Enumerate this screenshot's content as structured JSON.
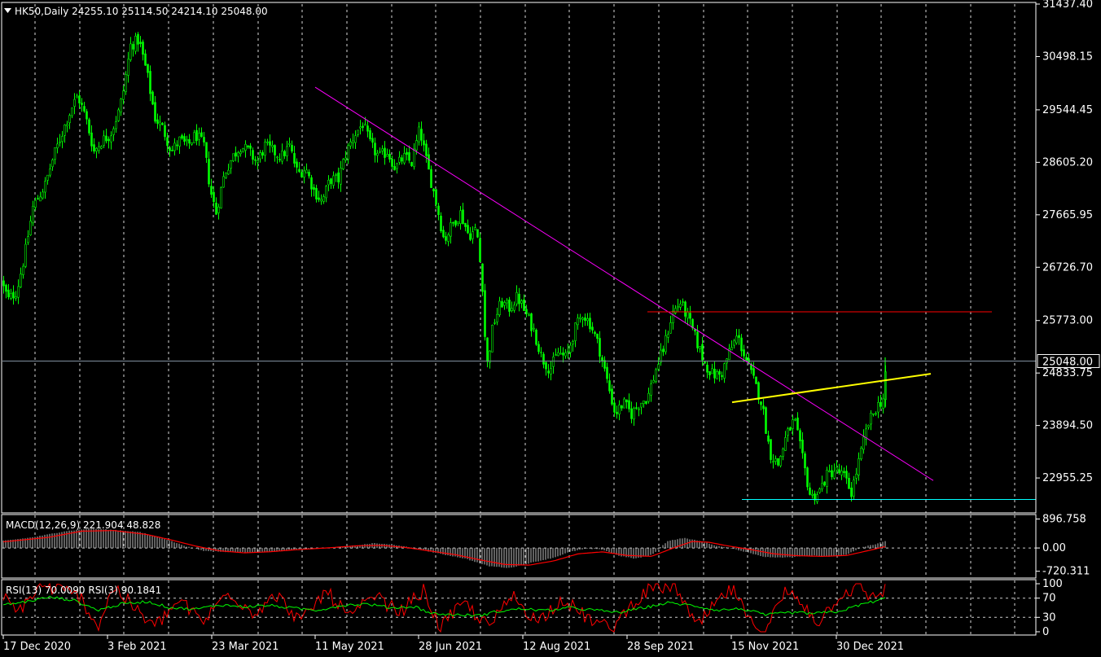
{
  "chart_data": [
    {
      "type": "candlestick",
      "title": "HK50,Daily  24255.10 25114.50 24214.10 25048.00",
      "symbol": "HK50,Daily",
      "ohlc_header": "24255.10 25114.50 24214.10 25048.00",
      "ylim": [
        22330,
        31437.4
      ],
      "y_ticks": [
        "31437.40",
        "30498.15",
        "29544.45",
        "28605.20",
        "27665.95",
        "26726.70",
        "25773.00",
        "24833.75",
        "23894.50",
        "22955.25"
      ],
      "y_tick_values": [
        31437.4,
        30498.15,
        29544.45,
        28605.2,
        27665.95,
        26726.7,
        25773.0,
        24833.75,
        23894.5,
        22955.25
      ],
      "current_price": "25048.00",
      "current_price_value": 25048.0,
      "x_ticks": [
        "17 Dec 2020",
        "3 Feb 2021",
        "23 Mar 2021",
        "11 May 2021",
        "28 Jun 2021",
        "12 Aug 2021",
        "28 Sep 2021",
        "15 Nov 2021",
        "30 Dec 2021"
      ],
      "close_path": [
        [
          0,
          26500
        ],
        [
          10,
          26150
        ],
        [
          20,
          26300
        ],
        [
          30,
          26950
        ],
        [
          40,
          27800
        ],
        [
          55,
          28200
        ],
        [
          65,
          28700
        ],
        [
          80,
          29300
        ],
        [
          88,
          29600
        ],
        [
          95,
          29800
        ],
        [
          105,
          29400
        ],
        [
          115,
          28800
        ],
        [
          125,
          29000
        ],
        [
          135,
          29100
        ],
        [
          145,
          29500
        ],
        [
          150,
          29800
        ],
        [
          160,
          30700
        ],
        [
          170,
          30800
        ],
        [
          180,
          30200
        ],
        [
          190,
          29400
        ],
        [
          200,
          29200
        ],
        [
          210,
          28800
        ],
        [
          220,
          29000
        ],
        [
          230,
          28900
        ],
        [
          240,
          29100
        ],
        [
          250,
          28900
        ],
        [
          258,
          28100
        ],
        [
          265,
          27700
        ],
        [
          275,
          28400
        ],
        [
          285,
          28700
        ],
        [
          295,
          28900
        ],
        [
          305,
          28800
        ],
        [
          315,
          28600
        ],
        [
          325,
          28900
        ],
        [
          335,
          28800
        ],
        [
          345,
          28700
        ],
        [
          355,
          28900
        ],
        [
          365,
          28400
        ],
        [
          375,
          28500
        ],
        [
          385,
          28100
        ],
        [
          395,
          27900
        ],
        [
          405,
          28300
        ],
        [
          415,
          28300
        ],
        [
          425,
          28800
        ],
        [
          435,
          29100
        ],
        [
          445,
          29300
        ],
        [
          455,
          28900
        ],
        [
          465,
          28700
        ],
        [
          475,
          28800
        ],
        [
          485,
          28500
        ],
        [
          495,
          28700
        ],
        [
          505,
          28600
        ],
        [
          515,
          29200
        ],
        [
          525,
          28500
        ],
        [
          535,
          27900
        ],
        [
          545,
          27200
        ],
        [
          555,
          27500
        ],
        [
          565,
          27700
        ],
        [
          575,
          27300
        ],
        [
          585,
          27400
        ],
        [
          592,
          26400
        ],
        [
          597,
          24900
        ],
        [
          605,
          25700
        ],
        [
          615,
          26100
        ],
        [
          625,
          26000
        ],
        [
          635,
          26200
        ],
        [
          645,
          25900
        ],
        [
          655,
          25600
        ],
        [
          665,
          25100
        ],
        [
          675,
          24900
        ],
        [
          685,
          25200
        ],
        [
          695,
          25100
        ],
        [
          705,
          25600
        ],
        [
          715,
          25900
        ],
        [
          725,
          25700
        ],
        [
          735,
          25300
        ],
        [
          745,
          24700
        ],
        [
          755,
          24100
        ],
        [
          765,
          24300
        ],
        [
          775,
          24100
        ],
        [
          785,
          24300
        ],
        [
          795,
          24400
        ],
        [
          805,
          24900
        ],
        [
          815,
          25300
        ],
        [
          825,
          25900
        ],
        [
          835,
          26100
        ],
        [
          845,
          25800
        ],
        [
          855,
          25400
        ],
        [
          865,
          25000
        ],
        [
          875,
          24800
        ],
        [
          885,
          24800
        ],
        [
          895,
          25200
        ],
        [
          905,
          25500
        ],
        [
          915,
          25100
        ],
        [
          925,
          24700
        ],
        [
          935,
          24300
        ],
        [
          945,
          23400
        ],
        [
          955,
          23200
        ],
        [
          965,
          23700
        ],
        [
          975,
          24000
        ],
        [
          985,
          23300
        ],
        [
          995,
          22600
        ],
        [
          1005,
          22700
        ],
        [
          1015,
          23000
        ],
        [
          1025,
          23100
        ],
        [
          1035,
          23000
        ],
        [
          1045,
          22700
        ],
        [
          1055,
          23300
        ],
        [
          1065,
          23900
        ],
        [
          1075,
          24200
        ],
        [
          1085,
          24400
        ],
        [
          1088,
          25048
        ]
      ],
      "trendlines": [
        {
          "color": "#ff00ff",
          "from": [
            387,
            29950
          ],
          "to": [
            1146,
            22910
          ]
        },
        {
          "color": "#ff0000",
          "from": [
            795,
            25930
          ],
          "to": [
            1218,
            25930
          ]
        },
        {
          "color": "#ffff00",
          "from": [
            899,
            24310
          ],
          "to": [
            1143,
            24820
          ]
        },
        {
          "color": "#00ffff",
          "from": [
            911,
            22570
          ],
          "to": [
            1272,
            22570
          ]
        }
      ]
    },
    {
      "type": "indicator",
      "title": "MACD(12,26,9) 221.904 48.828",
      "y_ticks": [
        "896.758",
        "0.00",
        "-720.311"
      ],
      "y_tick_values": [
        896.758,
        0,
        -720.311
      ],
      "ylim": [
        -930,
        1010
      ],
      "histogram_color": "#c0c0c0",
      "signal_color": "#ff0000",
      "histogram": [
        [
          0,
          210
        ],
        [
          40,
          330
        ],
        [
          80,
          520
        ],
        [
          110,
          600
        ],
        [
          140,
          560
        ],
        [
          170,
          500
        ],
        [
          200,
          300
        ],
        [
          230,
          40
        ],
        [
          250,
          -90
        ],
        [
          280,
          -120
        ],
        [
          310,
          -140
        ],
        [
          340,
          -100
        ],
        [
          370,
          -30
        ],
        [
          400,
          0
        ],
        [
          430,
          60
        ],
        [
          460,
          150
        ],
        [
          490,
          80
        ],
        [
          520,
          -70
        ],
        [
          540,
          -180
        ],
        [
          570,
          -320
        ],
        [
          600,
          -560
        ],
        [
          625,
          -620
        ],
        [
          650,
          -470
        ],
        [
          680,
          -300
        ],
        [
          700,
          -120
        ],
        [
          720,
          -20
        ],
        [
          740,
          -50
        ],
        [
          760,
          -240
        ],
        [
          780,
          -330
        ],
        [
          800,
          -220
        ],
        [
          820,
          220
        ],
        [
          840,
          310
        ],
        [
          860,
          210
        ],
        [
          880,
          70
        ],
        [
          900,
          -20
        ],
        [
          920,
          -150
        ],
        [
          940,
          -280
        ],
        [
          960,
          -300
        ],
        [
          980,
          -260
        ],
        [
          1000,
          -230
        ],
        [
          1020,
          -270
        ],
        [
          1040,
          -200
        ],
        [
          1060,
          30
        ],
        [
          1075,
          120
        ],
        [
          1088,
          221.9
        ]
      ],
      "signal": [
        [
          0,
          180
        ],
        [
          60,
          330
        ],
        [
          100,
          520
        ],
        [
          140,
          540
        ],
        [
          180,
          420
        ],
        [
          210,
          250
        ],
        [
          240,
          60
        ],
        [
          270,
          -90
        ],
        [
          300,
          -150
        ],
        [
          330,
          -120
        ],
        [
          360,
          -60
        ],
        [
          400,
          0
        ],
        [
          440,
          70
        ],
        [
          470,
          80
        ],
        [
          500,
          10
        ],
        [
          530,
          -100
        ],
        [
          560,
          -210
        ],
        [
          590,
          -370
        ],
        [
          620,
          -510
        ],
        [
          650,
          -530
        ],
        [
          680,
          -400
        ],
        [
          710,
          -180
        ],
        [
          740,
          -120
        ],
        [
          770,
          -230
        ],
        [
          800,
          -260
        ],
        [
          830,
          30
        ],
        [
          850,
          200
        ],
        [
          870,
          180
        ],
        [
          890,
          80
        ],
        [
          920,
          -40
        ],
        [
          950,
          -180
        ],
        [
          980,
          -240
        ],
        [
          1010,
          -260
        ],
        [
          1040,
          -230
        ],
        [
          1070,
          -60
        ],
        [
          1088,
          48.8
        ]
      ]
    },
    {
      "type": "indicator",
      "title": "RSI(13) 70.0090  RSI(3) 90.1841",
      "y_ticks": [
        "100",
        "70",
        "30",
        "0"
      ],
      "y_tick_values": [
        100,
        70,
        30,
        0
      ],
      "ylim": [
        0,
        100
      ],
      "rsi13_color": "#00ff00",
      "rsi3_color": "#ff0000",
      "levels": [
        70,
        30
      ],
      "rsi13": [
        [
          0,
          55
        ],
        [
          30,
          62
        ],
        [
          60,
          72
        ],
        [
          90,
          66
        ],
        [
          120,
          45
        ],
        [
          150,
          58
        ],
        [
          180,
          63
        ],
        [
          210,
          50
        ],
        [
          240,
          47
        ],
        [
          270,
          56
        ],
        [
          300,
          52
        ],
        [
          330,
          55
        ],
        [
          360,
          49
        ],
        [
          390,
          45
        ],
        [
          420,
          55
        ],
        [
          450,
          58
        ],
        [
          480,
          50
        ],
        [
          510,
          52
        ],
        [
          530,
          38
        ],
        [
          560,
          35
        ],
        [
          590,
          34
        ],
        [
          610,
          42
        ],
        [
          640,
          48
        ],
        [
          670,
          44
        ],
        [
          700,
          50
        ],
        [
          730,
          45
        ],
        [
          760,
          40
        ],
        [
          790,
          50
        ],
        [
          820,
          60
        ],
        [
          850,
          55
        ],
        [
          880,
          45
        ],
        [
          910,
          48
        ],
        [
          940,
          35
        ],
        [
          970,
          40
        ],
        [
          1000,
          38
        ],
        [
          1030,
          42
        ],
        [
          1060,
          58
        ],
        [
          1075,
          64
        ],
        [
          1088,
          70
        ]
      ],
      "rsi3": [
        [
          0,
          80
        ],
        [
          20,
          40
        ],
        [
          50,
          95
        ],
        [
          80,
          85
        ],
        [
          100,
          70
        ],
        [
          120,
          10
        ],
        [
          140,
          95
        ],
        [
          170,
          40
        ],
        [
          190,
          10
        ],
        [
          220,
          65
        ],
        [
          250,
          20
        ],
        [
          280,
          85
        ],
        [
          310,
          40
        ],
        [
          340,
          75
        ],
        [
          370,
          20
        ],
        [
          400,
          85
        ],
        [
          430,
          30
        ],
        [
          460,
          75
        ],
        [
          490,
          40
        ],
        [
          520,
          85
        ],
        [
          540,
          10
        ],
        [
          570,
          60
        ],
        [
          600,
          10
        ],
        [
          630,
          75
        ],
        [
          660,
          20
        ],
        [
          690,
          70
        ],
        [
          720,
          30
        ],
        [
          750,
          5
        ],
        [
          780,
          65
        ],
        [
          800,
          90
        ],
        [
          830,
          95
        ],
        [
          855,
          8
        ],
        [
          880,
          60
        ],
        [
          900,
          90
        ],
        [
          920,
          20
        ],
        [
          940,
          5
        ],
        [
          965,
          85
        ],
        [
          985,
          60
        ],
        [
          1005,
          20
        ],
        [
          1030,
          75
        ],
        [
          1055,
          95
        ],
        [
          1070,
          70
        ],
        [
          1088,
          90
        ]
      ]
    }
  ]
}
